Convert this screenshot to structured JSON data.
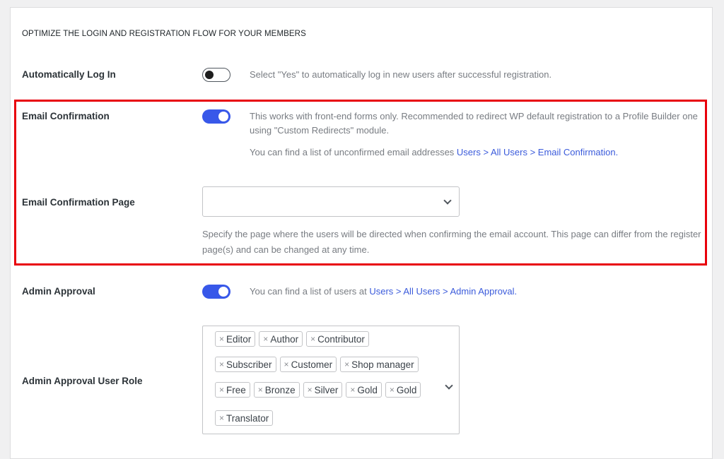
{
  "section": {
    "title": "OPTIMIZE THE LOGIN AND REGISTRATION FLOW FOR YOUR MEMBERS"
  },
  "settings": {
    "auto_login": {
      "label": "Automatically Log In",
      "enabled": false,
      "description": "Select \"Yes\" to automatically log in new users after successful registration."
    },
    "email_confirmation": {
      "label": "Email Confirmation",
      "enabled": true,
      "description": "This works with front-end forms only. Recommended to redirect WP default registration to a Profile Builder one using \"Custom Redirects\" module.",
      "list_prefix": "You can find a list of unconfirmed email addresses ",
      "list_link": "Users > All Users > Email Confirmation."
    },
    "email_confirmation_page": {
      "label": "Email Confirmation Page",
      "selected_value": "",
      "description": "Specify the page where the users will be directed when confirming the email account. This page can differ from the register page(s) and can be changed at any time."
    },
    "admin_approval": {
      "label": "Admin Approval",
      "enabled": true,
      "list_prefix": "You can find a list of users at ",
      "list_link": "Users > All Users > Admin Approval."
    },
    "admin_approval_user_role": {
      "label": "Admin Approval User Role",
      "remove_glyph": "×",
      "rows": [
        [
          "Editor",
          "Author",
          "Contributor"
        ],
        [
          "Subscriber",
          "Customer",
          "Shop manager"
        ],
        [
          "Free",
          "Bronze",
          "Silver",
          "Gold",
          "Gold"
        ],
        [
          "Translator"
        ]
      ]
    }
  },
  "colors": {
    "accent": "#3858e9",
    "highlight_border": "#e8000b",
    "link": "#3b5bdb"
  },
  "icons": {
    "dropdown": "chevron-down-icon",
    "remove_tag": "close-icon"
  }
}
